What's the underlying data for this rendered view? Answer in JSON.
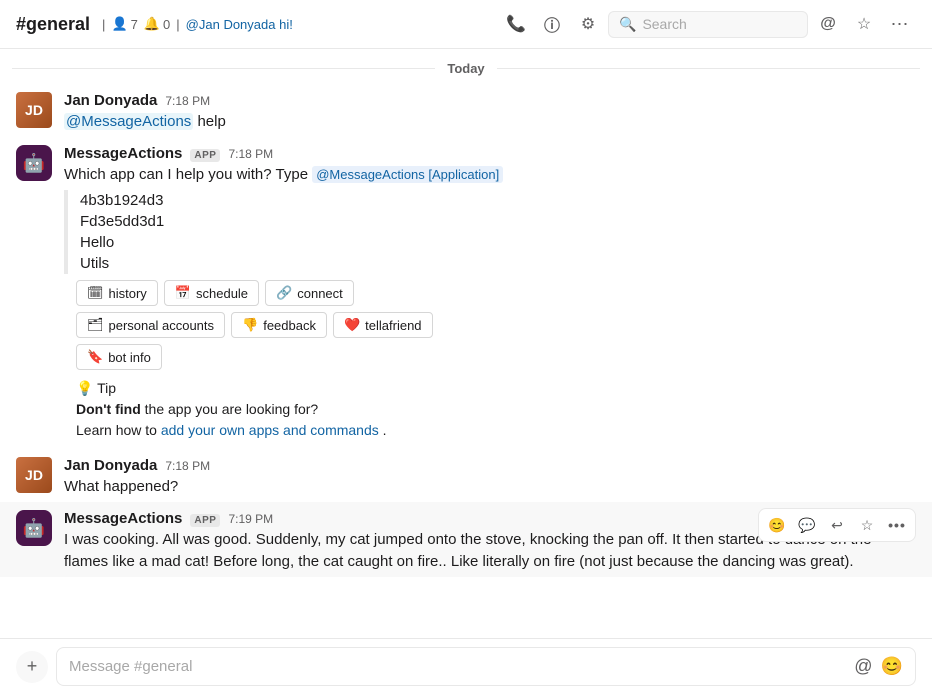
{
  "header": {
    "channel": "#general",
    "member_count": "7",
    "notif_count": "0",
    "mention_text": "@Jan Donyada hi!",
    "search_placeholder": "Search",
    "icons": {
      "phone": "📞",
      "info": "ℹ",
      "settings": "⚙",
      "at": "@",
      "star": "☆",
      "more": "•••"
    }
  },
  "date_divider": "Today",
  "messages": [
    {
      "id": "msg1",
      "avatar_type": "human",
      "sender": "Jan Donyada",
      "timestamp": "7:18 PM",
      "text_parts": [
        {
          "type": "mention",
          "value": "@MessageActions"
        },
        {
          "type": "text",
          "value": " help"
        }
      ]
    },
    {
      "id": "msg2",
      "avatar_type": "bot",
      "sender": "MessageActions",
      "app_badge": "APP",
      "timestamp": "7:18 PM",
      "intro": "Which app can I help you with? Type ",
      "app_mention": "@MessageActions [Application]",
      "list_items": [
        "4b3b1924d3",
        "Fd3e5dd3d1",
        "Hello",
        "Utils"
      ],
      "btn_row1": [
        {
          "icon": "🗓",
          "label": "history"
        },
        {
          "icon": "📅",
          "label": "schedule"
        },
        {
          "icon": "🔗",
          "label": "connect"
        }
      ],
      "btn_row2": [
        {
          "icon": "🗂",
          "label": "personal accounts"
        },
        {
          "icon": "👎",
          "label": "feedback"
        },
        {
          "icon": "❤",
          "label": "tellafriend"
        }
      ],
      "btn_row3": [
        {
          "icon": "🔖",
          "label": "bot info"
        }
      ],
      "tip_bulb": "💡",
      "tip_label": "Tip",
      "tip_text_before": "Don't find",
      "tip_text_bold": "Don't find",
      "tip_middle": " the app you are looking for?",
      "tip_line2_before": "Learn how to ",
      "tip_link": "add your own apps and commands",
      "tip_line2_after": "."
    },
    {
      "id": "msg3",
      "avatar_type": "human",
      "sender": "Jan Donyada",
      "timestamp": "7:18 PM",
      "text": "What happened?"
    },
    {
      "id": "msg4",
      "avatar_type": "bot",
      "sender": "MessageActions",
      "app_badge": "APP",
      "timestamp": "7:19 PM",
      "text": "I was cooking. All was good. Suddenly, my cat jumped onto the stove, knocking the pan off. It then started to dance on the flames like a mad cat! Before long, the cat caught on fire.. Like literally on fire (not just because the dancing was great).",
      "show_reactions": true,
      "reaction_icons": [
        "😊",
        "💬",
        "↩",
        "☆",
        "•••"
      ]
    }
  ],
  "input": {
    "placeholder": "Message #general",
    "emoji_icon": "😊",
    "at_icon": "@"
  }
}
